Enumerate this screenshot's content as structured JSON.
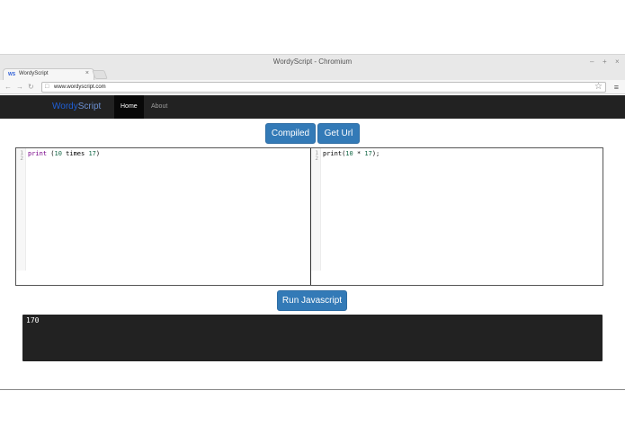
{
  "window": {
    "title": "WordyScript - Chromium",
    "controls": [
      "–",
      "+",
      "×"
    ]
  },
  "tab": {
    "favicon": "WS",
    "label": "WordyScript",
    "close": "×"
  },
  "address_bar": {
    "url": "www.wordyscript.com"
  },
  "navbar": {
    "brand_part1": "Wordy",
    "brand_part2": "Script",
    "items": [
      {
        "label": "Home",
        "active": true
      },
      {
        "label": "About",
        "active": false
      }
    ]
  },
  "buttons": {
    "compiled": "Compiled",
    "get_url": "Get Url",
    "run": "Run Javascript"
  },
  "editor_left": {
    "line_numbers": [
      "1",
      "2"
    ],
    "tokens": {
      "kw": "print",
      "open": " (",
      "a": "10",
      "word": " times ",
      "b": "17",
      "close": ")"
    }
  },
  "editor_right": {
    "line_numbers": [
      "1",
      "2"
    ],
    "tokens": {
      "pre": "print(",
      "a": "10",
      "op": " * ",
      "b": "17",
      "post": ");"
    }
  },
  "output": {
    "text": "170"
  },
  "colors": {
    "button_primary": "#337ab7",
    "navbar_bg": "#222222",
    "console_bg": "#222222"
  }
}
